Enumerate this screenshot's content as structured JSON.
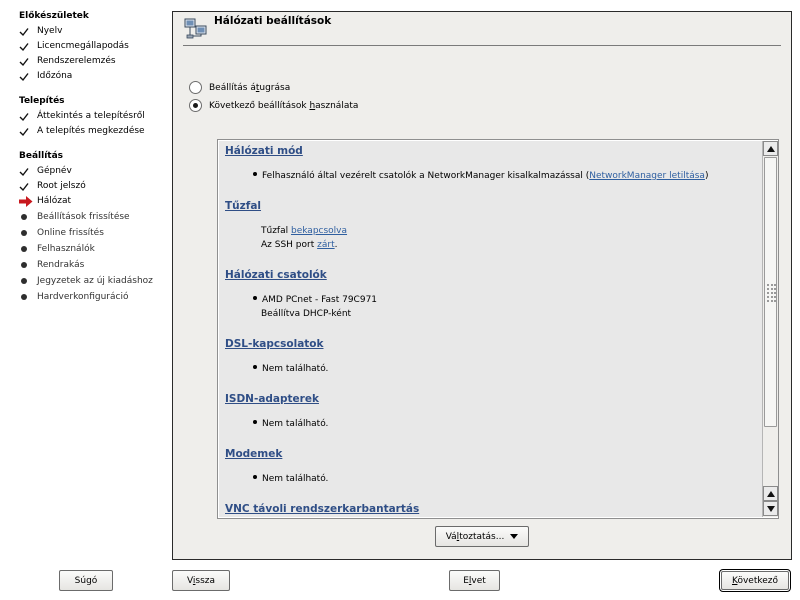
{
  "sidebar": {
    "sections": [
      {
        "heading": "Előkészületek",
        "items": [
          {
            "label": "Nyelv",
            "status": "done"
          },
          {
            "label": "Licencmegállapodás",
            "status": "done"
          },
          {
            "label": "Rendszerelemzés",
            "status": "done"
          },
          {
            "label": "Időzóna",
            "status": "done"
          }
        ]
      },
      {
        "heading": "Telepítés",
        "items": [
          {
            "label": "Áttekintés a telepítésről",
            "status": "done"
          },
          {
            "label": "A telepítés megkezdése",
            "status": "done"
          }
        ]
      },
      {
        "heading": "Beállítás",
        "items": [
          {
            "label": "Gépnév",
            "status": "done"
          },
          {
            "label": "Root jelszó",
            "status": "done"
          },
          {
            "label": "Hálózat",
            "status": "current"
          },
          {
            "label": "Beállítások frissítése",
            "status": "pending"
          },
          {
            "label": "Online frissítés",
            "status": "pending"
          },
          {
            "label": "Felhasználók",
            "status": "pending"
          },
          {
            "label": "Rendrakás",
            "status": "pending"
          },
          {
            "label": "Jegyzetek az új kiadáshoz",
            "status": "pending"
          },
          {
            "label": "Hardverkonfiguráció",
            "status": "pending"
          }
        ]
      }
    ]
  },
  "header": {
    "title": "Hálózati beállítások",
    "icon": "network-settings-icon"
  },
  "options": {
    "skip": {
      "pre": "Beállítás á",
      "accel": "t",
      "post": "ugrása",
      "checked": false
    },
    "use": {
      "pre": "Következő beállítások ",
      "accel": "h",
      "post": "asználata",
      "checked": true
    }
  },
  "summary": {
    "network_mode": {
      "title": "Hálózati mód",
      "text_pre": "Felhasználó által vezérelt csatolók a NetworkManager kisalkalmazással (",
      "link": "NetworkManager letiltása",
      "text_post": ")"
    },
    "firewall": {
      "title": "Tűzfal",
      "line1_pre": "Tűzfal ",
      "line1_link": "bekapcsolva",
      "line2_pre": "Az SSH port ",
      "line2_link": "zárt",
      "line2_post": "."
    },
    "interfaces": {
      "title": "Hálózati csatolók",
      "line1": "AMD PCnet - Fast 79C971",
      "line2": "Beállítva DHCP-ként"
    },
    "dsl": {
      "title": "DSL-kapcsolatok",
      "line": "Nem található."
    },
    "isdn": {
      "title": "ISDN-adapterek",
      "line": "Nem található."
    },
    "modems": {
      "title": "Modemek",
      "line": "Nem található."
    },
    "vnc": {
      "title": "VNC távoli rendszerkarbantartás"
    }
  },
  "change_button": {
    "pre": "Vá",
    "accel": "l",
    "post": "toztatás..."
  },
  "footer": {
    "help": "Súgó",
    "back": {
      "pre": "V",
      "accel": "i",
      "post": "ssza"
    },
    "abort": {
      "pre": "E",
      "accel": "l",
      "post": "vet"
    },
    "next": {
      "pre": "",
      "accel": "K",
      "post": "övetkező"
    }
  },
  "colors": {
    "link": "#2f5fa0",
    "section_title": "#2f4e86",
    "current_arrow": "#c8181e",
    "panel_bg": "#efeeeb"
  }
}
